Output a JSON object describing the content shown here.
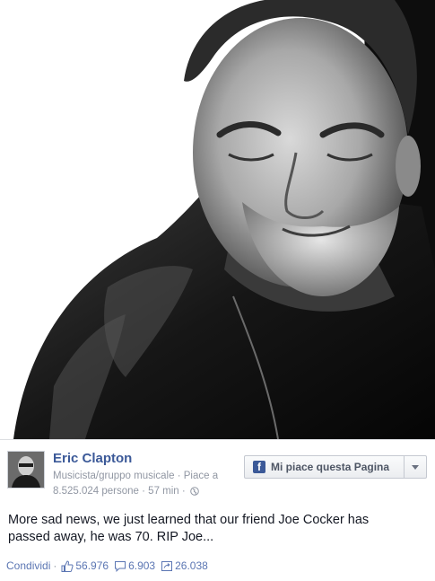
{
  "post": {
    "page_name": "Eric Clapton",
    "category": "Musicista/gruppo musicale",
    "likes_prefix": "Piace a",
    "likes_count": "8.525.024 persone",
    "time": "57 min",
    "dot": "·",
    "message_line1": "More sad news, we just learned that our friend Joe Cocker has",
    "message_line2": "passed away, he was 70. RIP Joe..."
  },
  "like_page_button": {
    "label": "Mi piace questa Pagina",
    "icon": "facebook-f-icon"
  },
  "actions": {
    "share_label": "Condividi",
    "separator": "·",
    "likes": "56.976",
    "comments": "6.903",
    "shares": "26.038"
  },
  "colors": {
    "link": "#3b5998",
    "muted": "#9197a3",
    "action": "#5b76b3",
    "brand": "#3b5998"
  }
}
